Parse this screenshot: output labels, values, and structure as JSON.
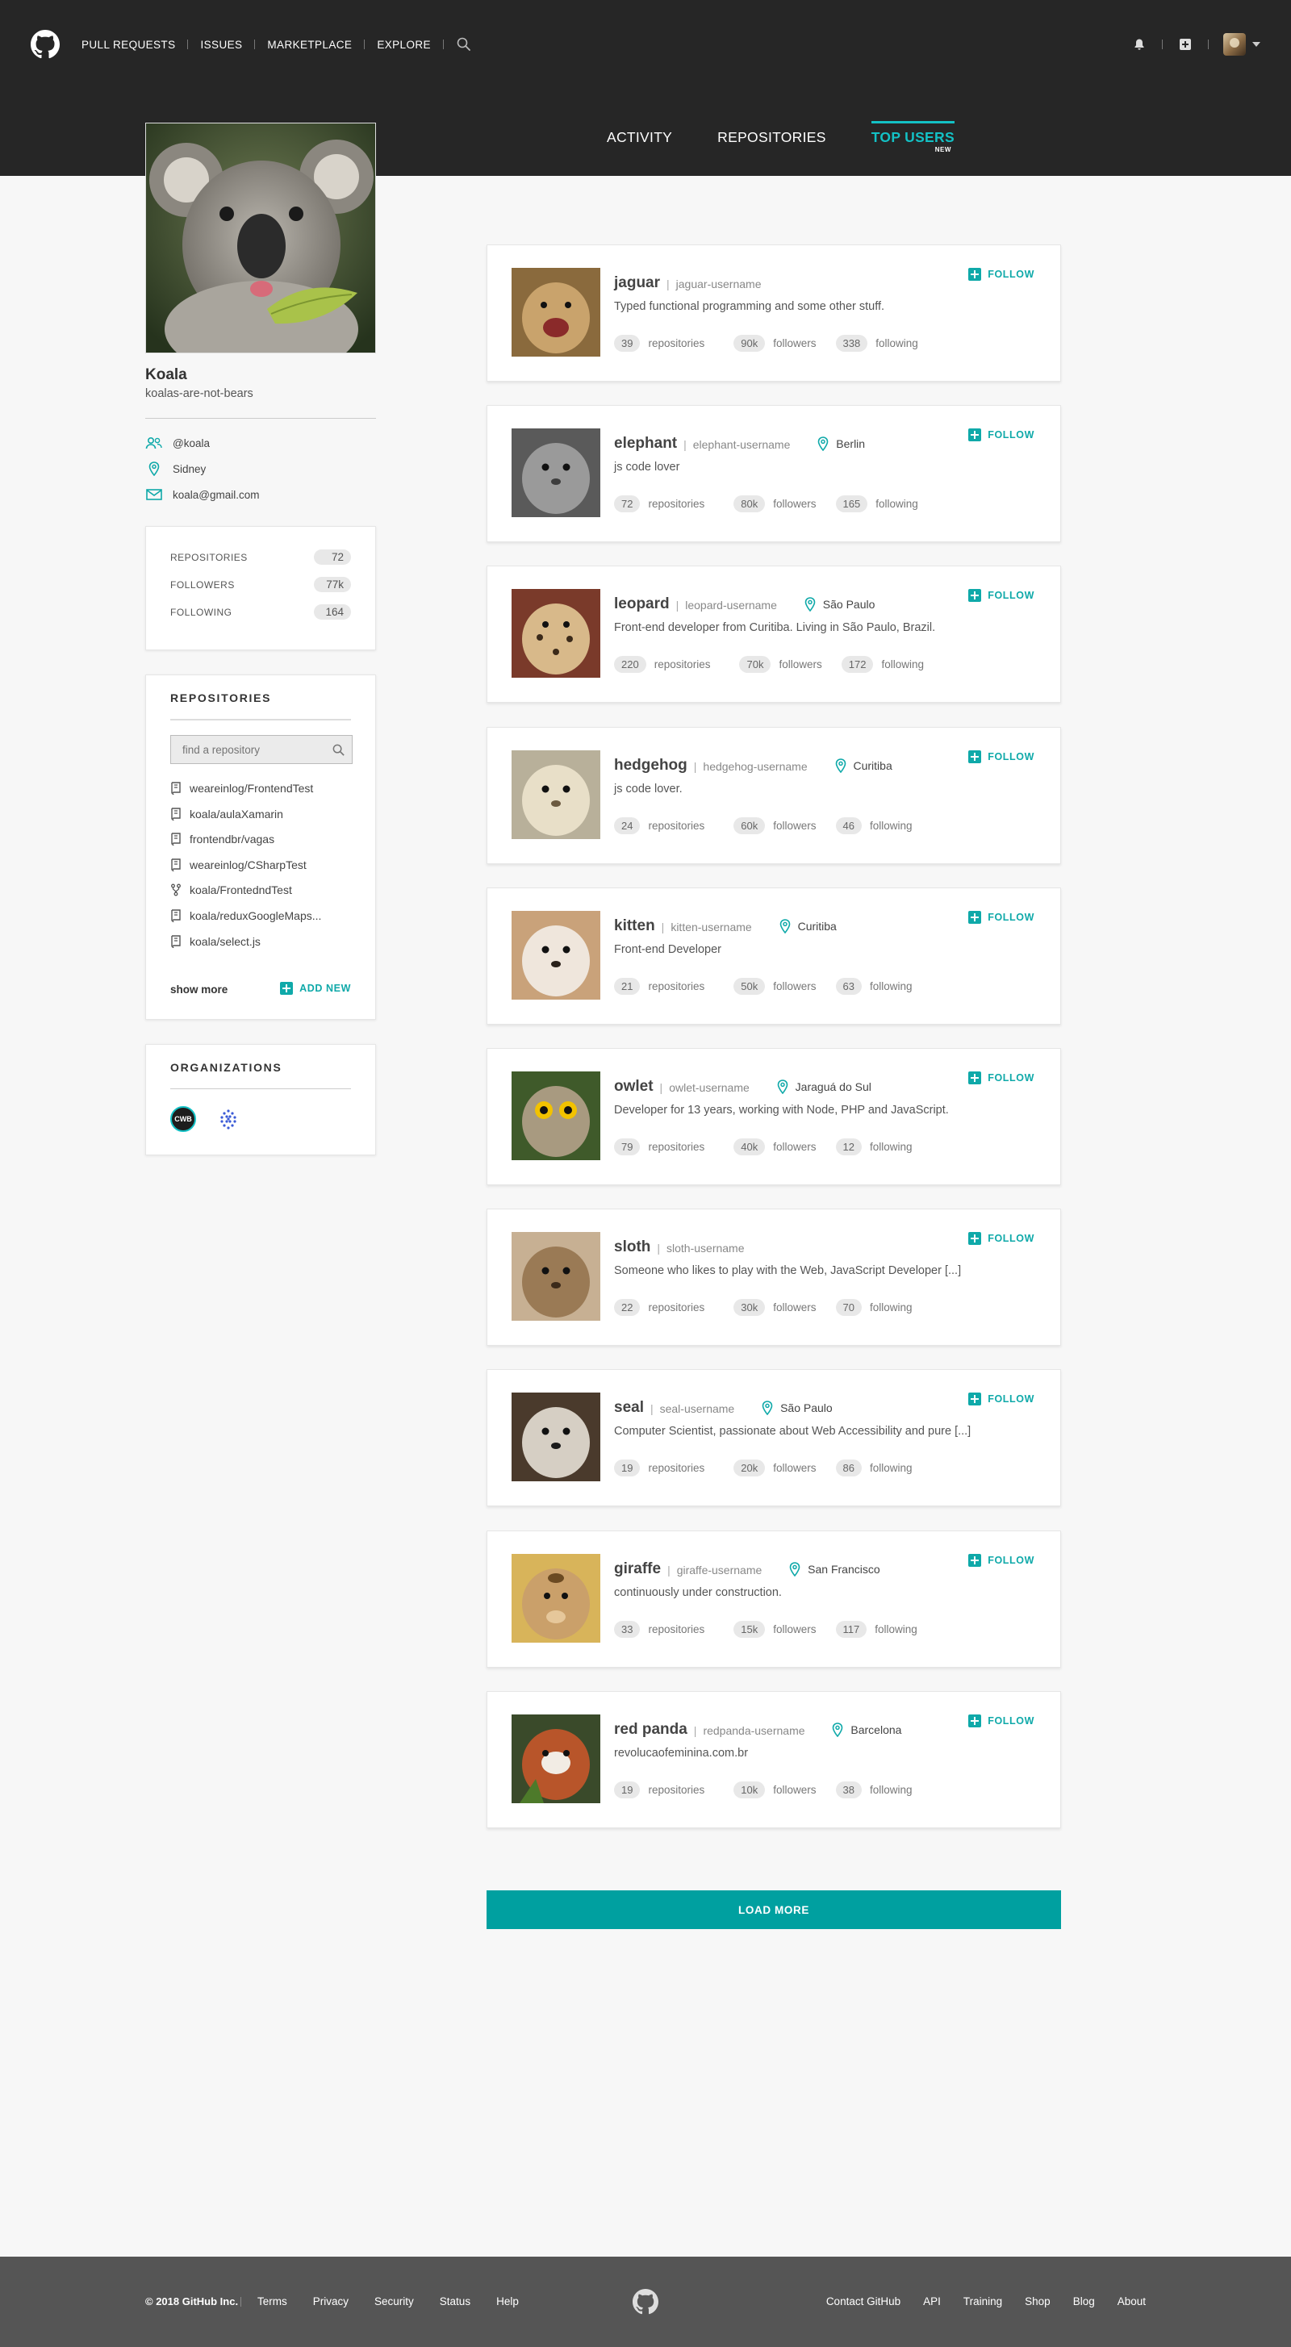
{
  "nav": {
    "items": [
      "PULL REQUESTS",
      "ISSUES",
      "MARKETPLACE",
      "EXPLORE"
    ]
  },
  "tabs": {
    "activity": "ACTIVITY",
    "repositories": "REPOSITORIES",
    "top_users": "TOP USERS",
    "new_badge": "NEW"
  },
  "profile": {
    "name": "Koala",
    "username": "koalas-are-not-bears",
    "org": "@koala",
    "location": "Sidney",
    "email": "koala@gmail.com"
  },
  "stats": {
    "repositories_label": "REPOSITORIES",
    "repositories_value": "72",
    "followers_label": "FOLLOWERS",
    "followers_value": "77k",
    "following_label": "FOLLOWING",
    "following_value": "164"
  },
  "repos": {
    "title": "REPOSITORIES",
    "search_placeholder": "find a repository",
    "items": [
      {
        "name": "weareinlog/FrontendTest",
        "icon": "repo-icon"
      },
      {
        "name": "koala/aulaXamarin",
        "icon": "repo-icon"
      },
      {
        "name": "frontendbr/vagas",
        "icon": "repo-icon"
      },
      {
        "name": "weareinlog/CSharpTest",
        "icon": "repo-icon"
      },
      {
        "name": "koala/FrontedndTest",
        "icon": "fork-icon"
      },
      {
        "name": "koala/reduxGoogleMaps...",
        "icon": "repo-icon"
      },
      {
        "name": "koala/select.js",
        "icon": "repo-icon"
      }
    ],
    "show_more": "show more",
    "add_new": "ADD NEW"
  },
  "orgs": {
    "title": "ORGANIZATIONS",
    "first_logo_text": "CWB"
  },
  "users": [
    {
      "name": "jaguar",
      "handle": "jaguar-username",
      "location": "",
      "bio": "Typed functional programming and some other stuff.",
      "repos": "39",
      "followers": "90k",
      "following": "338"
    },
    {
      "name": "elephant",
      "handle": "elephant-username",
      "location": "Berlin",
      "bio": "js code lover",
      "repos": "72",
      "followers": "80k",
      "following": "165"
    },
    {
      "name": "leopard",
      "handle": "leopard-username",
      "location": "São Paulo",
      "bio": "Front-end developer from Curitiba. Living in São Paulo, Brazil.",
      "repos": "220",
      "followers": "70k",
      "following": "172"
    },
    {
      "name": "hedgehog",
      "handle": "hedgehog-username",
      "location": "Curitiba",
      "bio": "js code lover.",
      "repos": "24",
      "followers": "60k",
      "following": "46"
    },
    {
      "name": "kitten",
      "handle": "kitten-username",
      "location": "Curitiba",
      "bio": "Front-end Developer",
      "repos": "21",
      "followers": "50k",
      "following": "63"
    },
    {
      "name": "owlet",
      "handle": "owlet-username",
      "location": "Jaraguá do Sul",
      "bio": "Developer for 13 years, working with Node, PHP and JavaScript.",
      "repos": "79",
      "followers": "40k",
      "following": "12"
    },
    {
      "name": "sloth",
      "handle": "sloth-username",
      "location": "",
      "bio": "Someone who likes to play with the Web, JavaScript Developer [...]",
      "repos": "22",
      "followers": "30k",
      "following": "70"
    },
    {
      "name": "seal",
      "handle": "seal-username",
      "location": "São Paulo",
      "bio": "Computer Scientist, passionate about Web Accessibility and pure [...]",
      "repos": "19",
      "followers": "20k",
      "following": "86"
    },
    {
      "name": "giraffe",
      "handle": "giraffe-username",
      "location": "San Francisco",
      "bio": "continuously under construction.",
      "repos": "33",
      "followers": "15k",
      "following": "117"
    },
    {
      "name": "red panda",
      "handle": "redpanda-username",
      "location": "Barcelona",
      "bio": "revolucaofeminina.com.br",
      "repos": "19",
      "followers": "10k",
      "following": "38"
    }
  ],
  "user_labels": {
    "repositories": "repositories",
    "followers": "followers",
    "following": "following",
    "follow": "FOLLOW"
  },
  "load_more": "LOAD MORE",
  "footer": {
    "copyright": "© 2018 GitHub Inc.",
    "left_links": [
      "Terms",
      "Privacy",
      "Security",
      "Status",
      "Help"
    ],
    "right_links": [
      "Contact GitHub",
      "API",
      "Training",
      "Shop",
      "Blog",
      "About"
    ]
  },
  "colors": {
    "accent": "#13c1c5",
    "teal": "#0fa9a9",
    "topbar": "#262626",
    "footer": "#555555"
  }
}
